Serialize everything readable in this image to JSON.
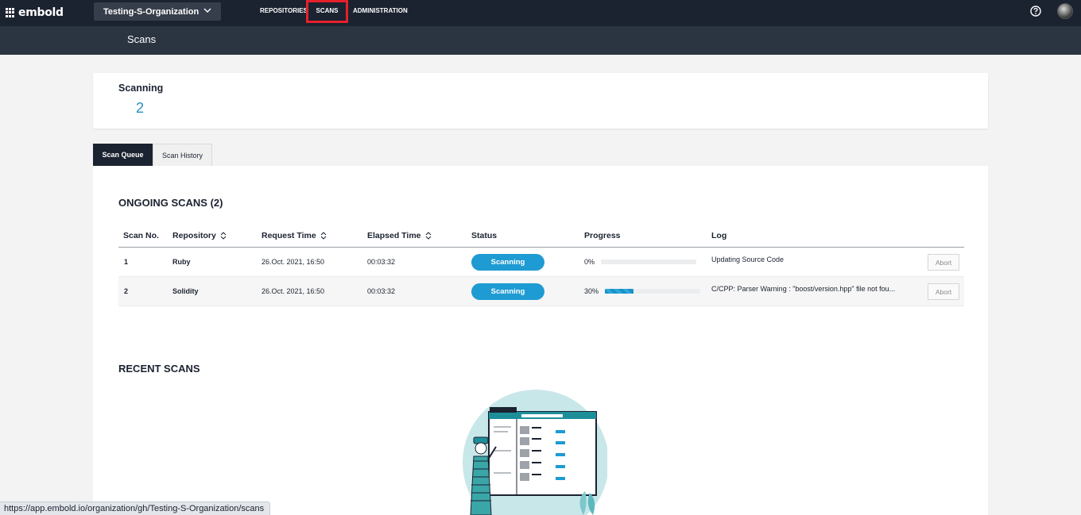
{
  "brand": {
    "name": "embold"
  },
  "org_selector": {
    "value": "Testing-S-Organization"
  },
  "nav": {
    "items": [
      "REPOSITORIES",
      "SCANS",
      "ADMINISTRATION"
    ],
    "active": "SCANS"
  },
  "header": {
    "title": "Scans"
  },
  "summary": {
    "label": "Scanning",
    "count": "2"
  },
  "tabs": [
    {
      "label": "Scan Queue",
      "active": true
    },
    {
      "label": "Scan History",
      "active": false
    }
  ],
  "ongoing": {
    "title": "ONGOING SCANS (2)",
    "columns": [
      "Scan No.",
      "Repository",
      "Request Time",
      "Elapsed Time",
      "Status",
      "Progress",
      "Log"
    ],
    "rows": [
      {
        "no": "1",
        "repository": "Ruby",
        "request_time": "26.Oct. 2021, 16:50",
        "elapsed": "00:03:32",
        "status": "Scanning",
        "progress_label": "0%",
        "progress": 0,
        "log": "Updating Source Code",
        "action": "Abort"
      },
      {
        "no": "2",
        "repository": "Solidity",
        "request_time": "26.Oct. 2021, 16:50",
        "elapsed": "00:03:32",
        "status": "Scanning",
        "progress_label": "30%",
        "progress": 0.3,
        "log": "C/CPP: Parser Warning : \"boost/version.hpp\" file not fou...",
        "action": "Abort"
      }
    ]
  },
  "recent": {
    "title": "RECENT SCANS"
  },
  "status_bar": {
    "url": "https://app.embold.io/organization/gh/Testing-S-Organization/scans"
  },
  "colors": {
    "nav_bg": "#1b2230",
    "subheader_bg": "#2b3441",
    "accent": "#1e9bd2",
    "highlight": "#e5202a"
  },
  "icons": {
    "help": "help-icon",
    "sort": "sort-icon",
    "dropdown": "chevron-down-icon"
  }
}
